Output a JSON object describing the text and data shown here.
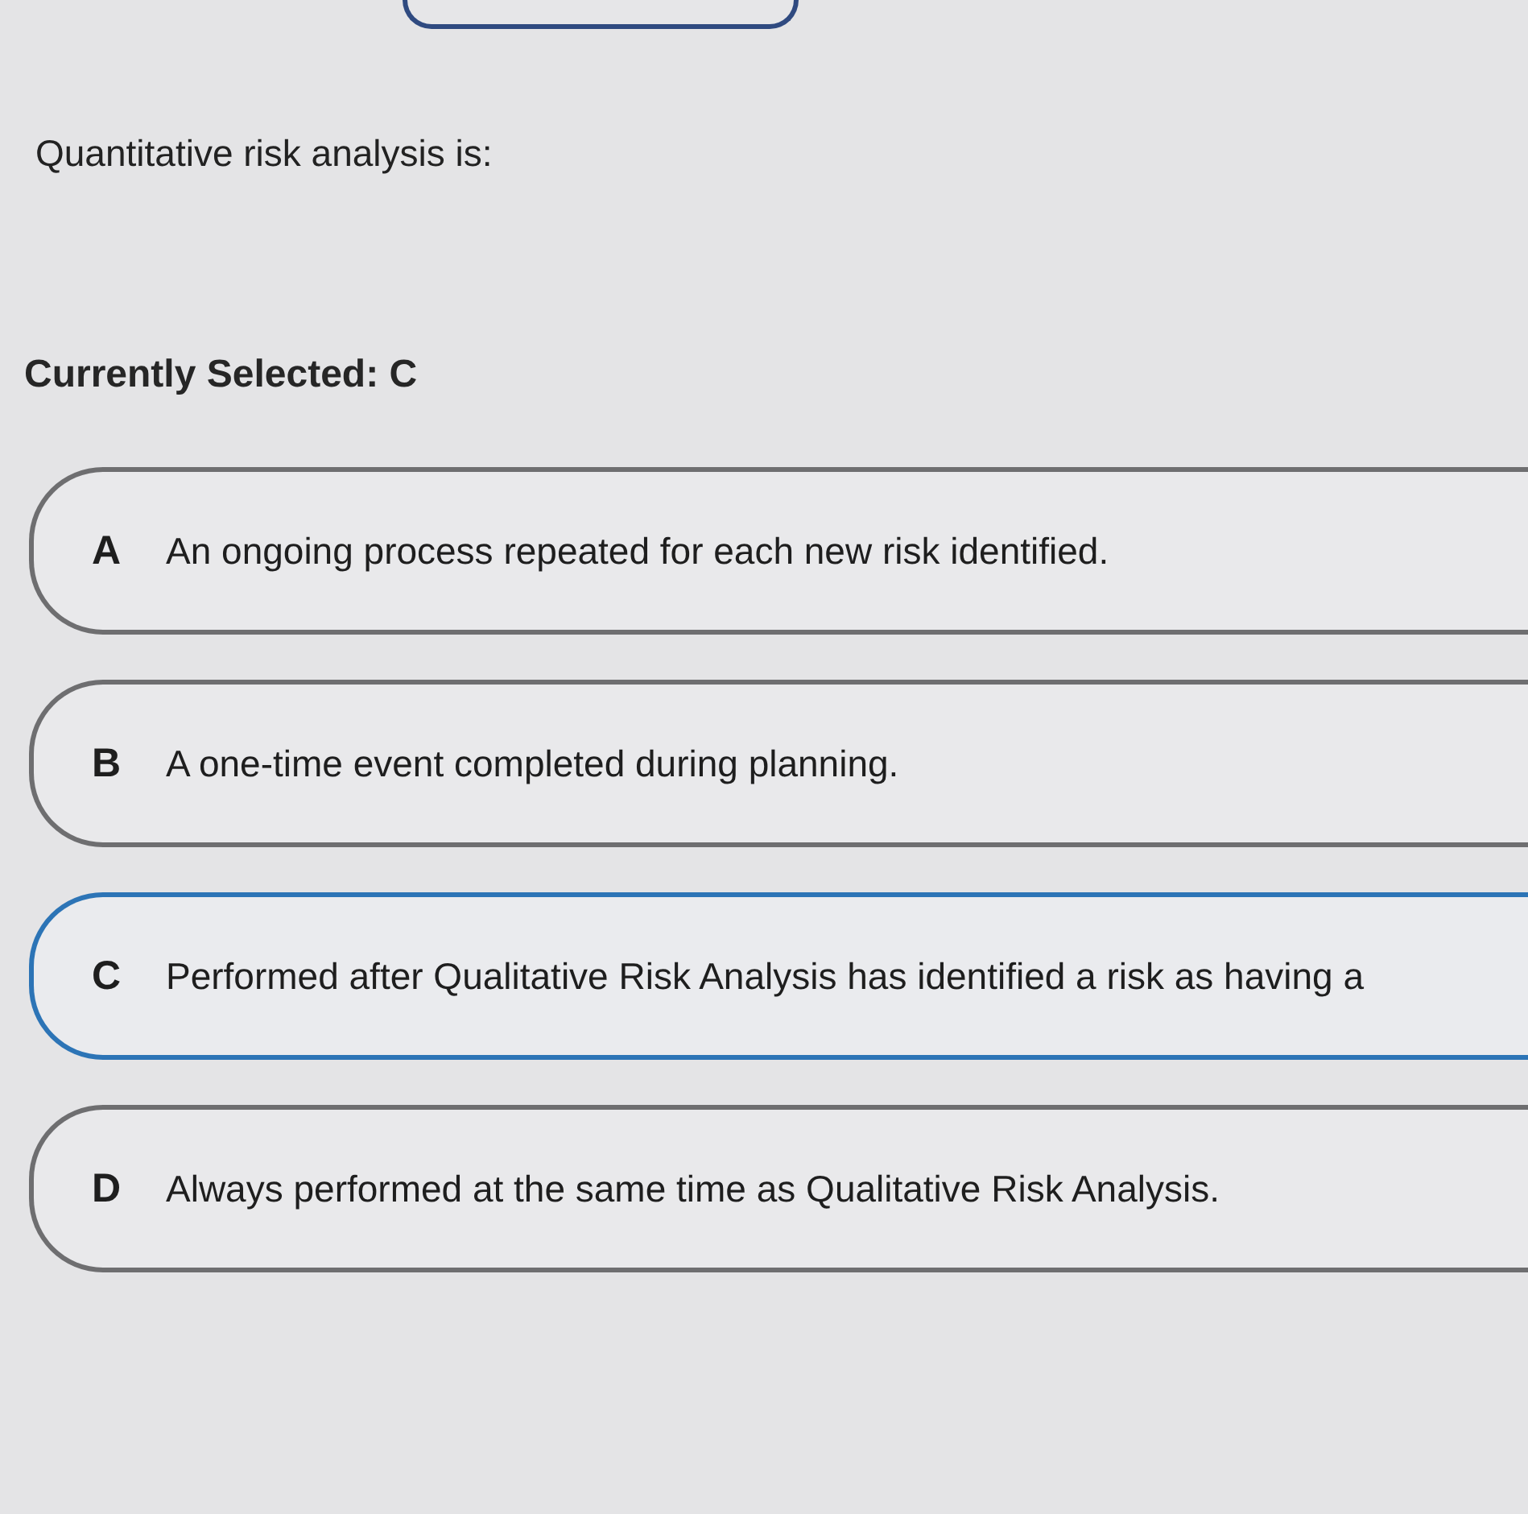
{
  "question": {
    "text": "Quantitative risk analysis is:"
  },
  "selection_status": "Currently Selected: C",
  "options": [
    {
      "letter": "A",
      "text": "An ongoing process repeated for each new risk identified.",
      "selected": false
    },
    {
      "letter": "B",
      "text": "A one-time event completed during planning.",
      "selected": false
    },
    {
      "letter": "C",
      "text": "Performed after Qualitative Risk Analysis has identified a risk as having a",
      "selected": true
    },
    {
      "letter": "D",
      "text": "Always performed at the same time as Qualitative Risk Analysis.",
      "selected": false
    }
  ]
}
